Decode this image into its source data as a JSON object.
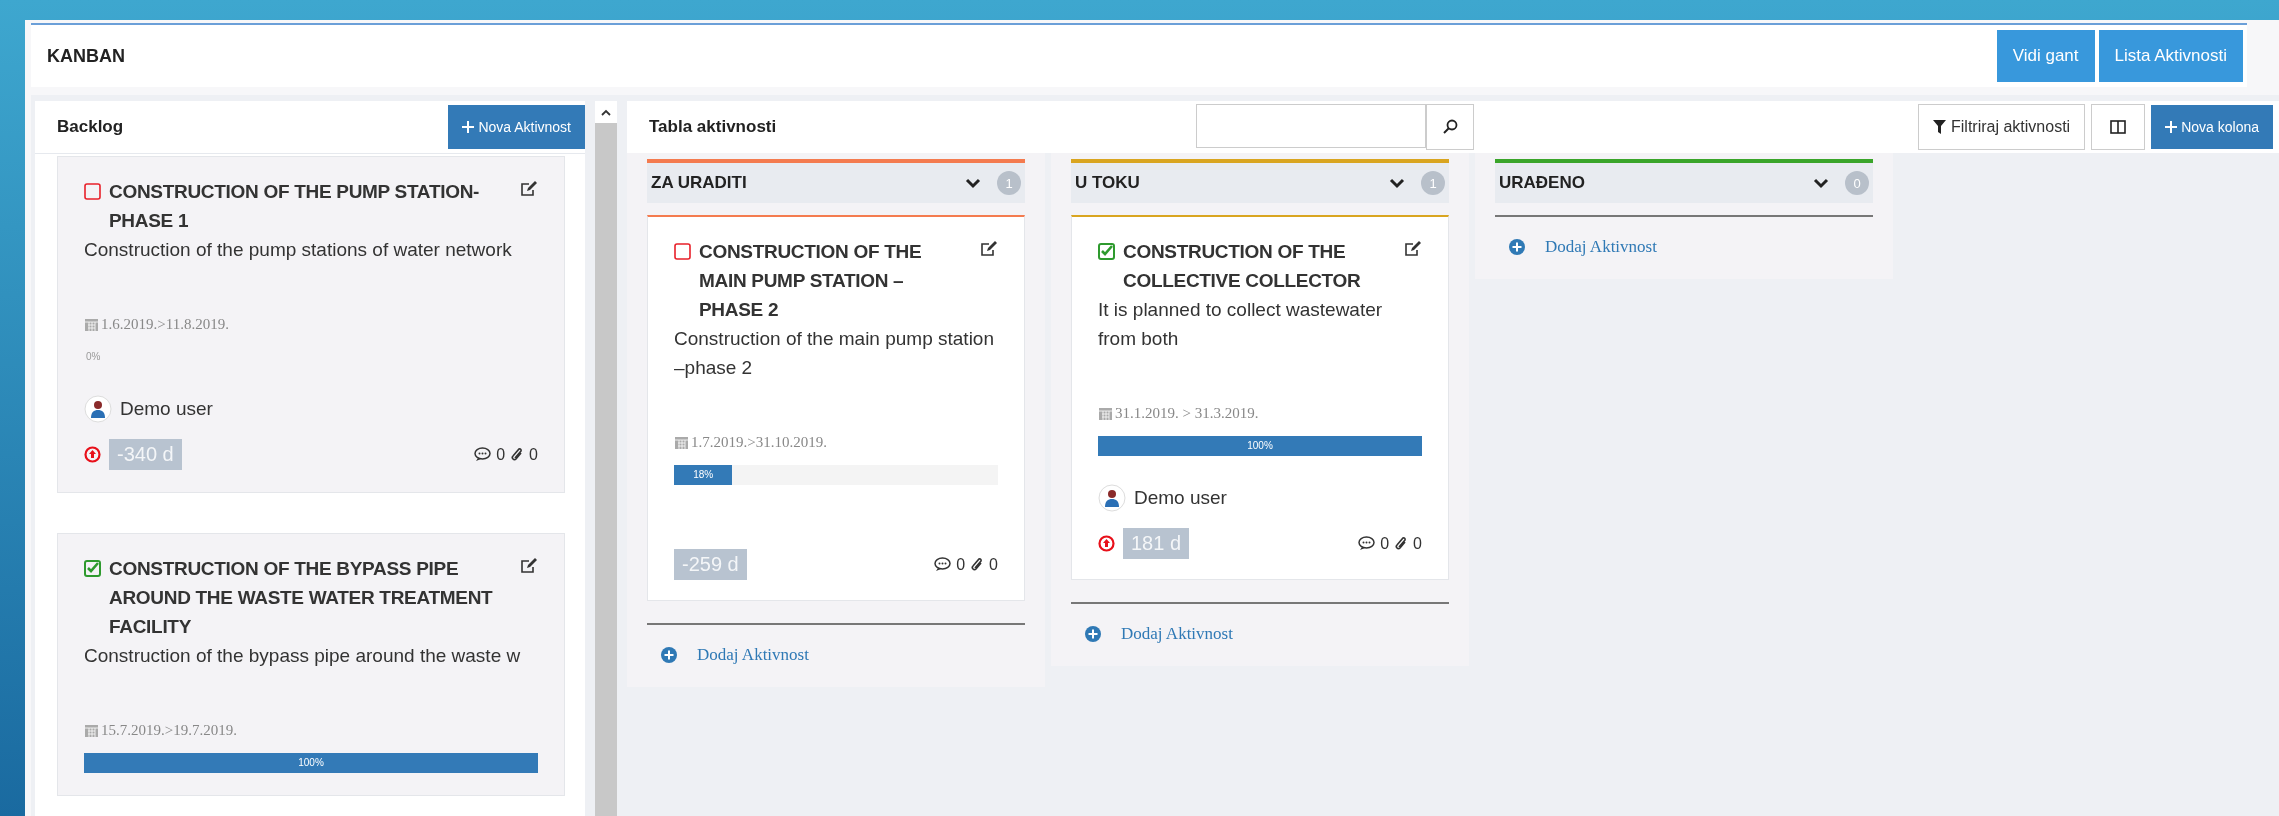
{
  "header": {
    "title": "KANBAN",
    "buttons": [
      "Vidi gant",
      "Lista Aktivnosti"
    ]
  },
  "backlog": {
    "title": "Backlog",
    "add_button": "Nova Aktivnost",
    "cards": [
      {
        "title": "CONSTRUCTION OF THE PUMP STATION-PHASE 1",
        "description": "Construction of the pump stations of water network",
        "done": false,
        "dates": "1.6.2019.>11.8.2019.",
        "progress": {
          "label": "0%"
        },
        "user": "Demo user",
        "overdue": true,
        "days": "-340 d",
        "comments": "0",
        "attachments": "0"
      },
      {
        "title": "CONSTRUCTION OF THE BYPASS PIPE AROUND THE WASTE WATER TREATMENT FACILITY",
        "description": "Construction of the bypass pipe around the waste w",
        "done": true,
        "dates": "15.7.2019.>19.7.2019.",
        "progress": {
          "level": 1,
          "label": "100%"
        }
      }
    ]
  },
  "board": {
    "title": "Tabla aktivnosti",
    "filter_button": "Filtriraj aktivnosti",
    "add_column_button": "Nova kolona",
    "columns": [
      {
        "name": "ZA URADITI",
        "color": "#f47b4f",
        "count": "1",
        "add_label": "Dodaj Aktivnost",
        "cards": [
          {
            "title": "CONSTRUCTION OF THE MAIN PUMP STATION –PHASE 2",
            "description": "Construction of the main pump station –phase 2",
            "done": false,
            "dates": "1.7.2019.>31.10.2019.",
            "progress": {
              "level": 0.18,
              "label": "18%"
            },
            "overdue": false,
            "days": "-259 d",
            "comments": "0",
            "attachments": "0"
          }
        ]
      },
      {
        "name": "U TOKU",
        "color": "#d9a520",
        "count": "1",
        "add_label": "Dodaj Aktivnost",
        "cards": [
          {
            "title": "CONSTRUCTION OF THE COLLECTIVE COLLECTOR",
            "description": "It is planned to collect wastewater from both",
            "done": true,
            "dates": "31.1.2019. > 31.3.2019.",
            "progress": {
              "level": 1,
              "label": "100%"
            },
            "user": "Demo user",
            "overdue": true,
            "days": "181 d",
            "comments": "0",
            "attachments": "0"
          }
        ]
      },
      {
        "name": "URAĐENO",
        "color": "#3aa52a",
        "count": "0",
        "add_label": "Dodaj Aktivnost"
      }
    ]
  }
}
